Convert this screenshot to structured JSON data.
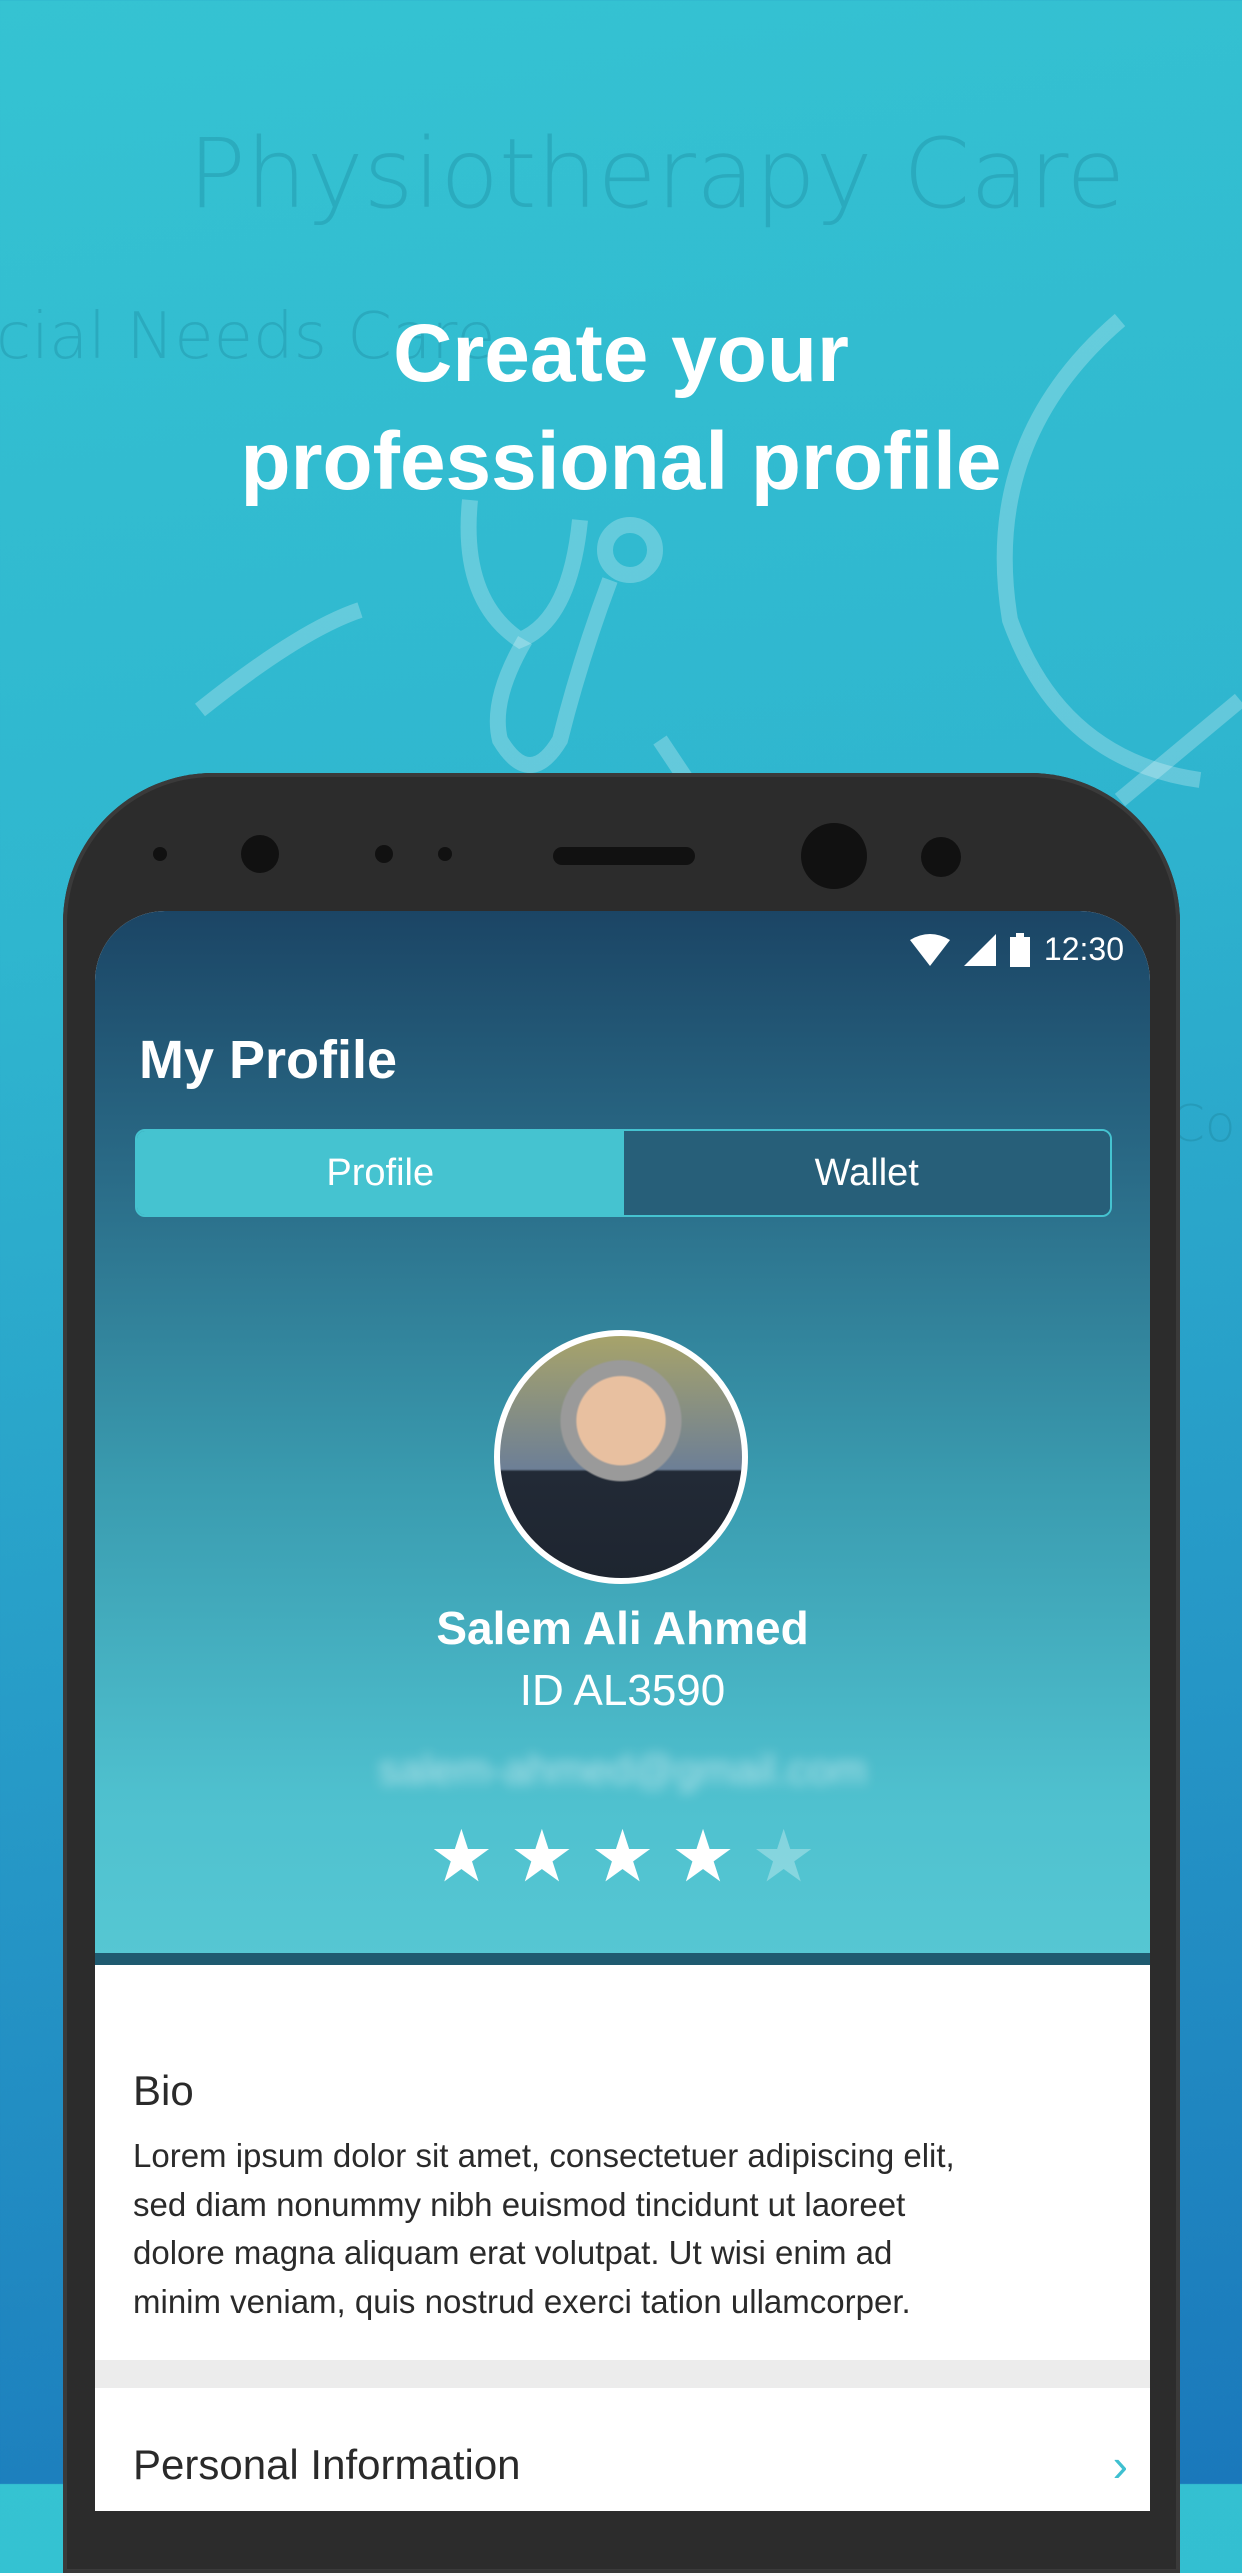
{
  "background": {
    "watermarks": [
      "Physiotherapy Care",
      "cial Needs Care",
      "Co"
    ]
  },
  "headline": {
    "line1": "Create your",
    "line2": "professional profile"
  },
  "status_bar": {
    "time": "12:30",
    "icons": [
      "wifi-icon",
      "signal-icon",
      "battery-icon"
    ]
  },
  "profile": {
    "title": "My Profile",
    "tabs": [
      {
        "label": "Profile",
        "active": true
      },
      {
        "label": "Wallet",
        "active": false
      }
    ],
    "name": "Salem Ali Ahmed",
    "id": "ID AL3590",
    "email": "salem-ahmed@gmail.com",
    "rating": {
      "value": 4,
      "max": 5
    }
  },
  "bio": {
    "heading": "Bio",
    "lines": [
      "Lorem ipsum dolor sit amet, consectetuer adipiscing elit,",
      "sed diam nonummy nibh euismod tincidunt ut laoreet",
      "dolore magna aliquam erat volutpat. Ut wisi enim ad",
      "minim veniam, quis nostrud exerci tation ullamcorper."
    ]
  },
  "personal_info": {
    "label": "Personal Information"
  },
  "colors": {
    "accent": "#45c3d0",
    "tab_inactive": "#275f79",
    "bg_top": "#35c3d2",
    "bg_bottom": "#1a78bb"
  }
}
